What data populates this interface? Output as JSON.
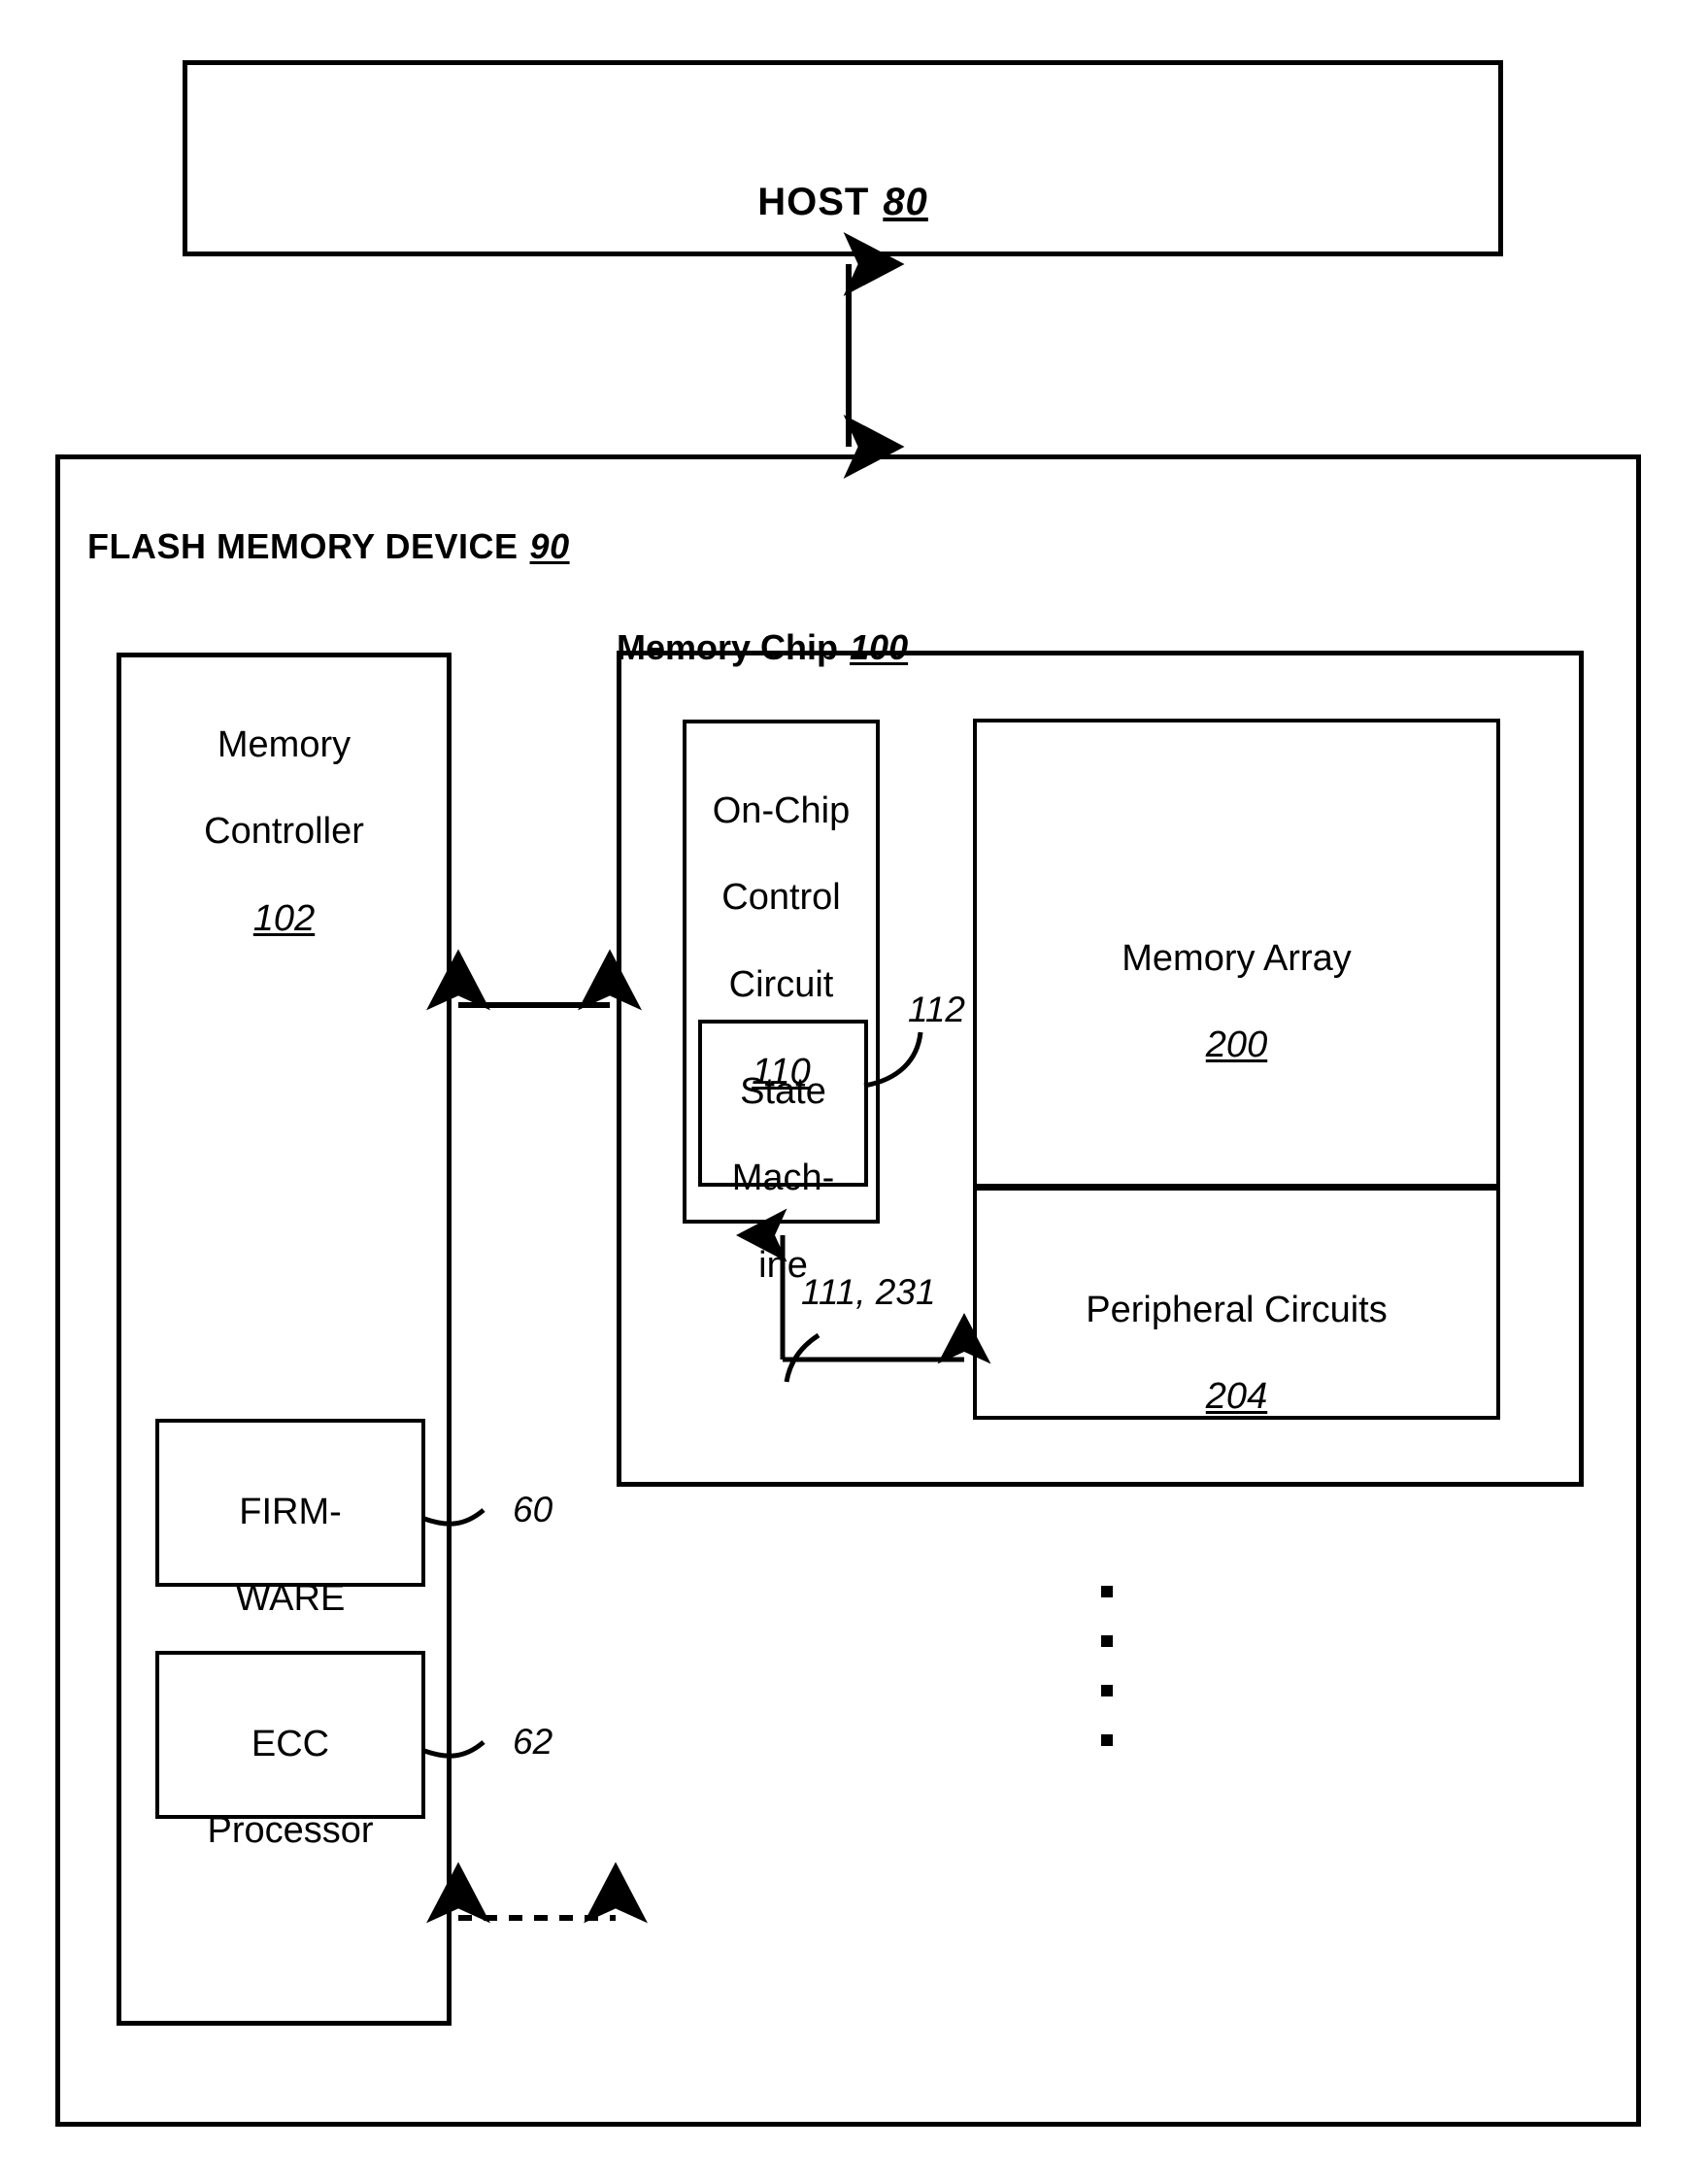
{
  "figure": {
    "host": {
      "label": "HOST",
      "ref": "80"
    },
    "device": {
      "label": "FLASH MEMORY DEVICE",
      "ref": "90"
    },
    "memory_chip": {
      "label": "Memory Chip",
      "ref": "100"
    },
    "memory_controller": {
      "line1": "Memory",
      "line2": "Controller",
      "ref": "102"
    },
    "on_chip_control": {
      "line1": "On-Chip",
      "line2": "Control",
      "line3": "Circuit",
      "ref": "110"
    },
    "state_machine": {
      "line1": "State",
      "line2": "Mach-",
      "line3": "ine",
      "ref": "112"
    },
    "memory_array": {
      "label": "Memory Array",
      "ref": "200"
    },
    "peripheral_circuits": {
      "label": "Peripheral Circuits",
      "ref": "204"
    },
    "firmware": {
      "line1": "FIRM-",
      "line2": "WARE",
      "ref": "60"
    },
    "ecc_processor": {
      "line1": "ECC",
      "line2": "Processor",
      "ref": "62"
    },
    "signal_labels": {
      "control_signals": "111, 231"
    },
    "colors": {
      "ink": "#000000",
      "paper": "#ffffff"
    }
  }
}
